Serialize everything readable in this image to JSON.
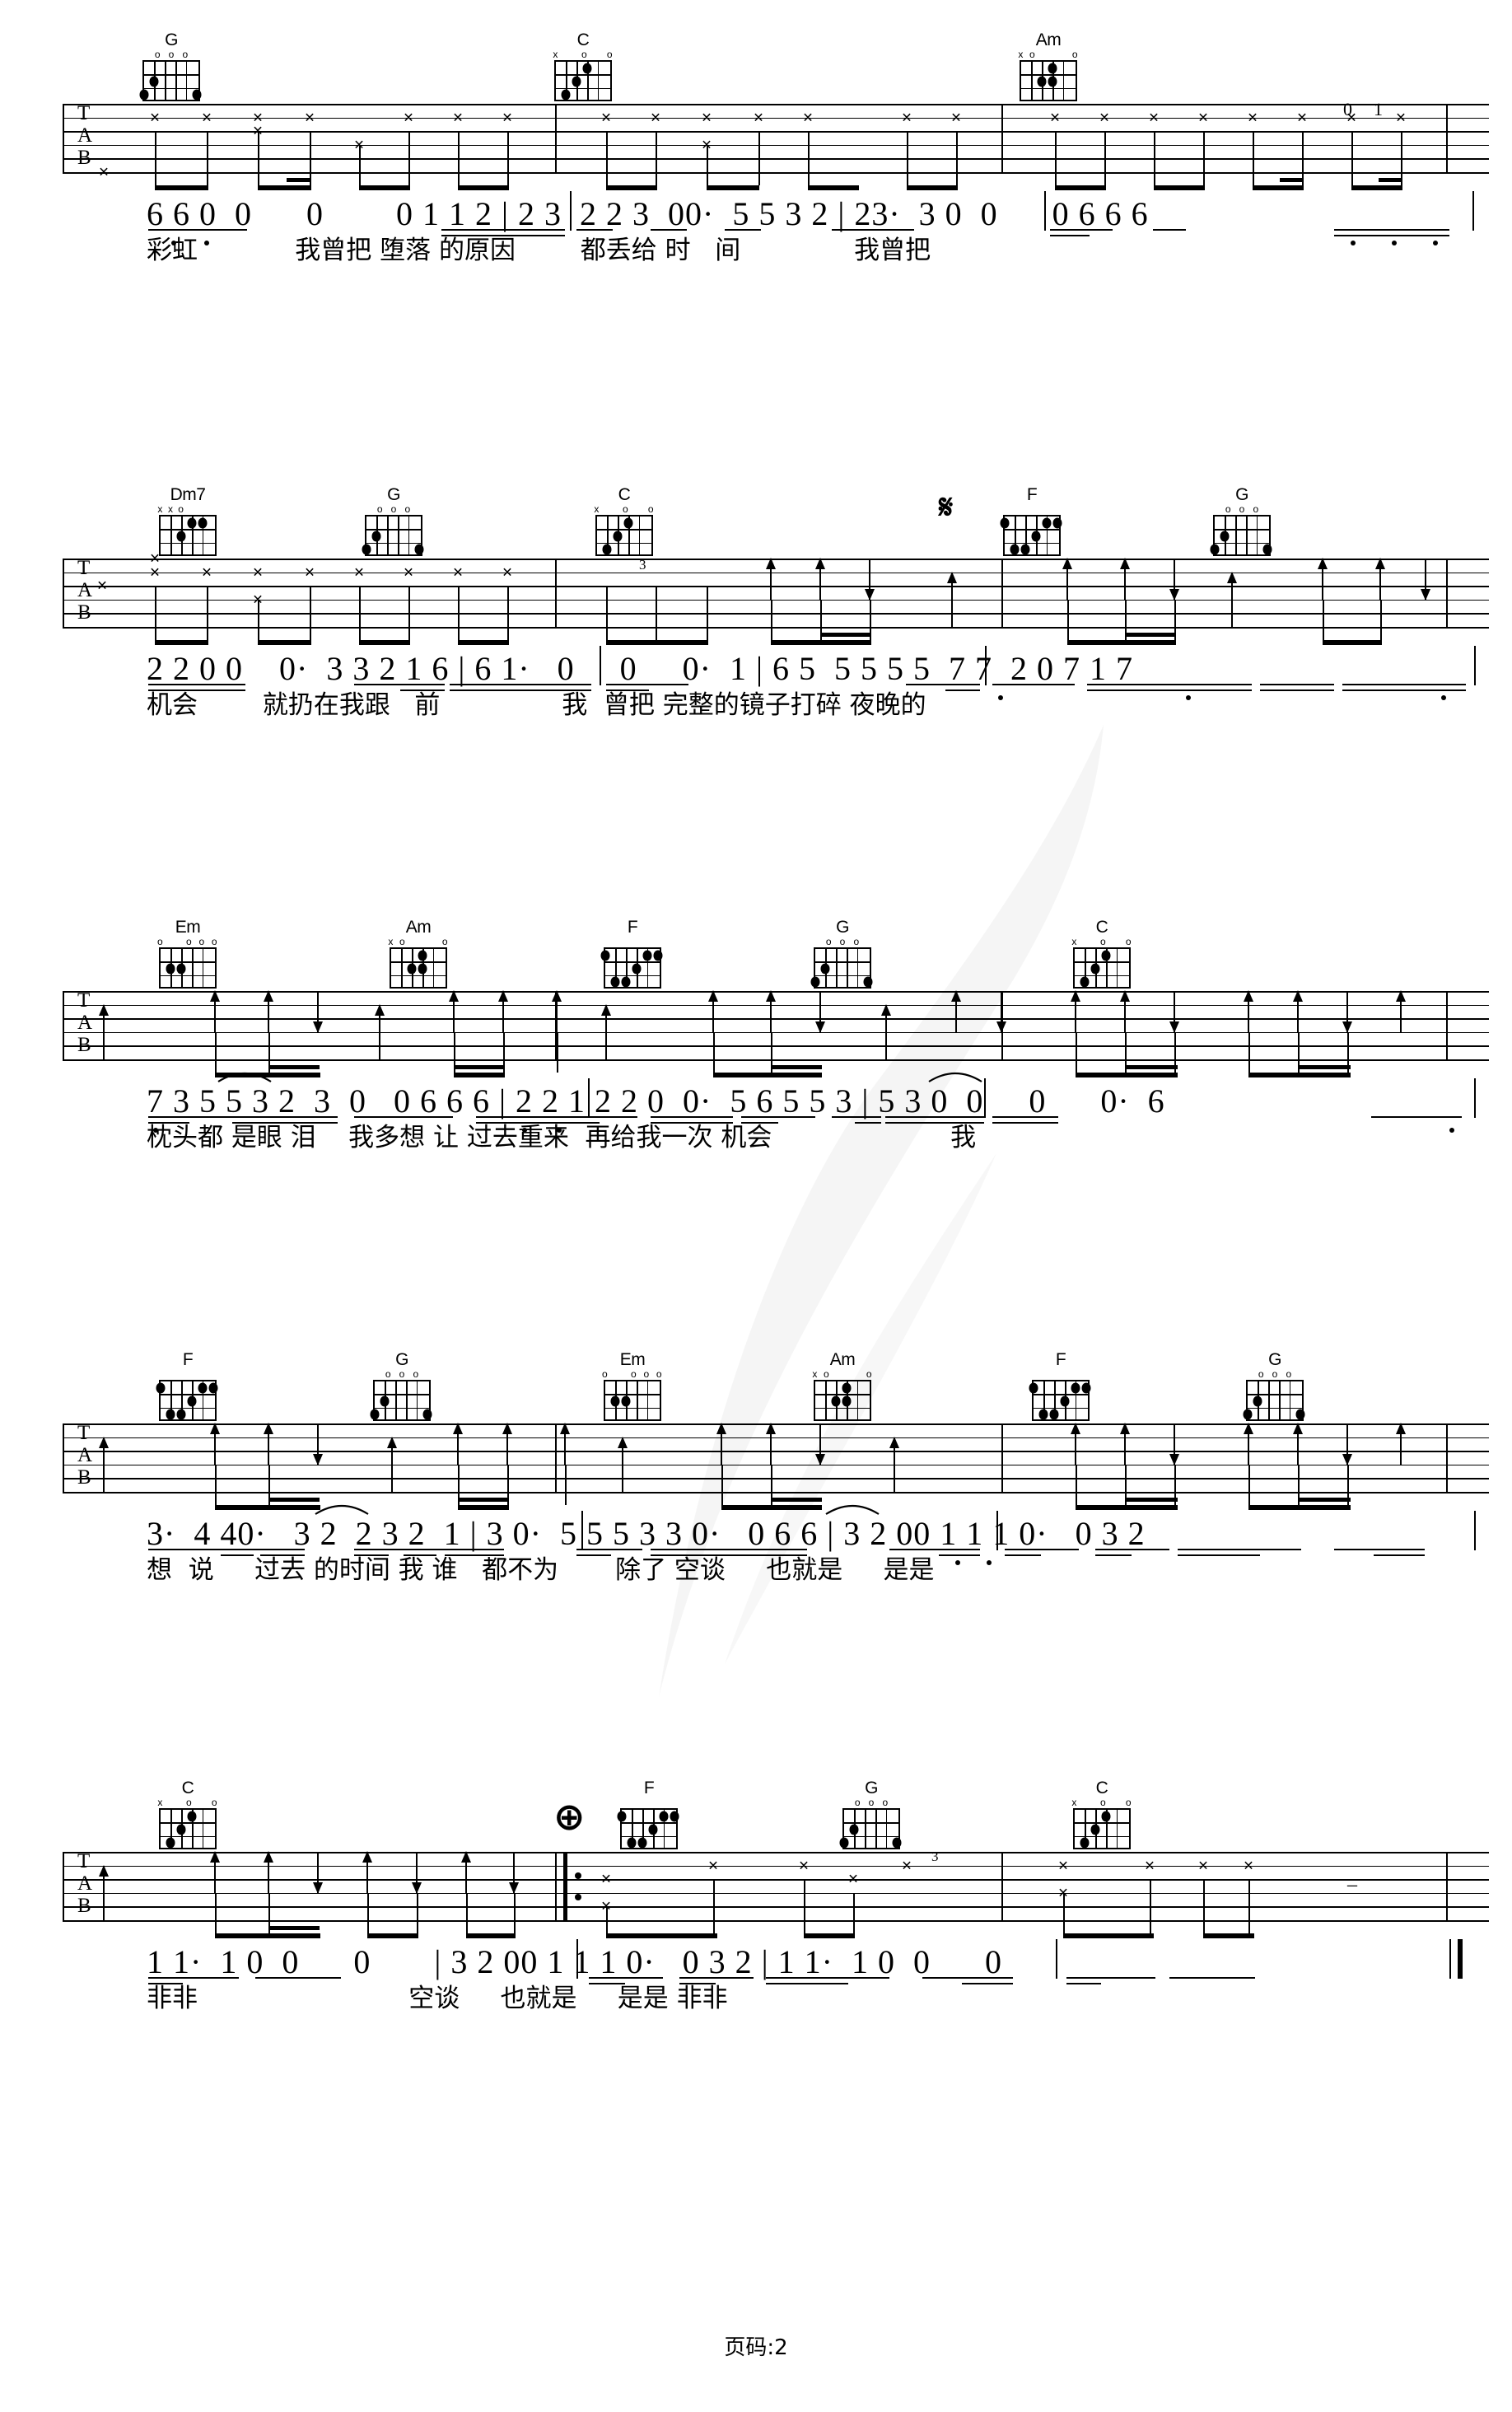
{
  "document": {
    "kind": "guitar-tab-and-numbered-notation",
    "footer_text": "页码:2"
  },
  "symbols": {
    "segno": "𝄋",
    "coda": "⊕",
    "mute_x": "×",
    "triplet": "3",
    "tab_letters": [
      "T",
      "A",
      "B"
    ]
  },
  "systems": [
    {
      "id": "system-1",
      "chords": [
        {
          "name": "G",
          "marks": [
            "",
            "",
            "o",
            "o",
            "o",
            ""
          ],
          "dots": [
            [
              2,
              5
            ],
            [
              3,
              2
            ],
            [
              3,
              1
            ],
            [
              0,
              0
            ]
          ]
        },
        {
          "name": "C",
          "marks": [
            "x",
            "",
            "",
            "o",
            "",
            "o"
          ],
          "dots": [
            [
              1,
              2
            ],
            [
              2,
              4
            ],
            [
              3,
              5
            ]
          ]
        },
        {
          "name": "Am",
          "marks": [
            "x",
            "o",
            "",
            "",
            "",
            "o"
          ],
          "dots": [
            [
              1,
              2
            ],
            [
              2,
              3
            ],
            [
              2,
              4
            ]
          ]
        }
      ],
      "numbers": "6 6 0  0      0        0 1 1 2 | 2 3  2 2 3  00·  5 5 3 2 | 23·  3 0  0      0 6 6 6",
      "lyrics": "彩虹            我曾把 堕落 的原因        都丢给 时   间              我曾把"
    },
    {
      "id": "system-2",
      "chords": [
        {
          "name": "Dm7",
          "marks": [
            "x",
            "x",
            "o",
            "",
            "",
            ""
          ],
          "dots": [
            [
              1,
              4
            ],
            [
              1,
              5
            ],
            [
              2,
              3
            ]
          ]
        },
        {
          "name": "G",
          "marks": [
            "",
            "",
            "o",
            "o",
            "o",
            ""
          ],
          "dots": [
            [
              2,
              5
            ],
            [
              3,
              2
            ],
            [
              3,
              1
            ],
            [
              0,
              0
            ]
          ]
        },
        {
          "name": "C",
          "marks": [
            "x",
            "",
            "",
            "o",
            "",
            "o"
          ],
          "dots": [
            [
              1,
              2
            ],
            [
              2,
              4
            ],
            [
              3,
              5
            ]
          ]
        },
        {
          "name": "F",
          "marks": [
            "",
            "",
            "",
            "",
            "",
            ""
          ],
          "dots": [
            [
              1,
              1
            ],
            [
              1,
              5
            ],
            [
              1,
              6
            ],
            [
              2,
              4
            ],
            [
              3,
              2
            ],
            [
              3,
              3
            ]
          ]
        },
        {
          "name": "G",
          "marks": [
            "",
            "",
            "o",
            "o",
            "o",
            ""
          ],
          "dots": [
            [
              2,
              5
            ],
            [
              3,
              2
            ],
            [
              3,
              1
            ],
            [
              0,
              0
            ]
          ]
        }
      ],
      "numbers": "2 2 0 0    0·  3 3 2 1 6 | 6 1·   0     0     0·  1 | 6 5  5 5 5 5  7 7  2 0 7 1 7",
      "lyrics": "机会        就扔在我跟   前               我  曾把 完整的镜子打碎 夜晚的",
      "segno_after_chord_index": 3
    },
    {
      "id": "system-3",
      "chords": [
        {
          "name": "Em",
          "marks": [
            "o",
            "",
            "",
            "o",
            "o",
            "o"
          ],
          "dots": [
            [
              2,
              4
            ],
            [
              2,
              5
            ]
          ]
        },
        {
          "name": "Am",
          "marks": [
            "x",
            "o",
            "",
            "",
            "",
            "o"
          ],
          "dots": [
            [
              1,
              2
            ],
            [
              2,
              3
            ],
            [
              2,
              4
            ]
          ]
        },
        {
          "name": "F",
          "marks": [
            "",
            "",
            "",
            "",
            "",
            ""
          ],
          "dots": [
            [
              1,
              1
            ],
            [
              1,
              5
            ],
            [
              1,
              6
            ],
            [
              2,
              4
            ],
            [
              3,
              2
            ],
            [
              3,
              3
            ]
          ]
        },
        {
          "name": "G",
          "marks": [
            "",
            "",
            "o",
            "o",
            "o",
            ""
          ],
          "dots": [
            [
              2,
              5
            ],
            [
              3,
              2
            ],
            [
              3,
              1
            ],
            [
              0,
              0
            ]
          ]
        },
        {
          "name": "C",
          "marks": [
            "x",
            "",
            "",
            "o",
            "",
            "o"
          ],
          "dots": [
            [
              1,
              2
            ],
            [
              2,
              4
            ],
            [
              3,
              5
            ]
          ]
        }
      ],
      "numbers": "7 3 5 5 3 2  3  0   0 6 6 6 | 2 2 1 2 2 0  0·  5 6 5 5 3 | 5 3 0  0     0      0·  6",
      "lyrics": "枕头都 是眼 泪    我多想 让 过去重来  再给我一次 机会                      我"
    },
    {
      "id": "system-4",
      "chords": [
        {
          "name": "F",
          "marks": [
            "",
            "",
            "",
            "",
            "",
            ""
          ],
          "dots": [
            [
              1,
              1
            ],
            [
              1,
              5
            ],
            [
              1,
              6
            ],
            [
              2,
              4
            ],
            [
              3,
              2
            ],
            [
              3,
              3
            ]
          ]
        },
        {
          "name": "G",
          "marks": [
            "",
            "",
            "o",
            "o",
            "o",
            ""
          ],
          "dots": [
            [
              2,
              5
            ],
            [
              3,
              2
            ],
            [
              3,
              1
            ],
            [
              0,
              0
            ]
          ]
        },
        {
          "name": "Em",
          "marks": [
            "o",
            "",
            "",
            "o",
            "o",
            "o"
          ],
          "dots": [
            [
              2,
              4
            ],
            [
              2,
              5
            ]
          ]
        },
        {
          "name": "Am",
          "marks": [
            "x",
            "o",
            "",
            "",
            "",
            "o"
          ],
          "dots": [
            [
              1,
              2
            ],
            [
              2,
              3
            ],
            [
              2,
              4
            ]
          ]
        },
        {
          "name": "F",
          "marks": [
            "",
            "",
            "",
            "",
            "",
            ""
          ],
          "dots": [
            [
              1,
              1
            ],
            [
              1,
              5
            ],
            [
              1,
              6
            ],
            [
              2,
              4
            ],
            [
              3,
              2
            ],
            [
              3,
              3
            ]
          ]
        },
        {
          "name": "G",
          "marks": [
            "",
            "",
            "o",
            "o",
            "o",
            ""
          ],
          "dots": [
            [
              2,
              5
            ],
            [
              3,
              2
            ],
            [
              3,
              1
            ],
            [
              0,
              0
            ]
          ]
        }
      ],
      "numbers": "3·  4 40·   3 2  2 3 2  1 | 3 0·  5 5 5 3 3 0·   0 6 6 | 3 2 00 1 1 1 0·   0 3 2",
      "lyrics": "想  说     过去 的时间 我 谁   都不为       除了 空谈     也就是     是是"
    },
    {
      "id": "system-5",
      "chords": [
        {
          "name": "C",
          "marks": [
            "x",
            "",
            "",
            "o",
            "",
            "o"
          ],
          "dots": [
            [
              1,
              2
            ],
            [
              2,
              4
            ],
            [
              3,
              5
            ]
          ]
        },
        {
          "name": "F",
          "marks": [
            "",
            "",
            "",
            "",
            "",
            ""
          ],
          "dots": [
            [
              1,
              1
            ],
            [
              1,
              5
            ],
            [
              1,
              6
            ],
            [
              2,
              4
            ],
            [
              3,
              2
            ],
            [
              3,
              3
            ]
          ]
        },
        {
          "name": "G",
          "marks": [
            "",
            "",
            "o",
            "o",
            "o",
            ""
          ],
          "dots": [
            [
              2,
              5
            ],
            [
              3,
              2
            ],
            [
              3,
              1
            ],
            [
              0,
              0
            ]
          ]
        },
        {
          "name": "C",
          "marks": [
            "x",
            "",
            "",
            "o",
            "",
            "o"
          ],
          "dots": [
            [
              1,
              2
            ],
            [
              2,
              4
            ],
            [
              3,
              5
            ]
          ]
        }
      ],
      "numbers": "1 1·  1 0  0      0       | 3 2 00 1 1 1 0·   0 3 2 | 1 1·  1 0  0      0",
      "lyrics": "非非                          空谈     也就是     是是 非非",
      "coda_before_chord_index": 1
    }
  ]
}
